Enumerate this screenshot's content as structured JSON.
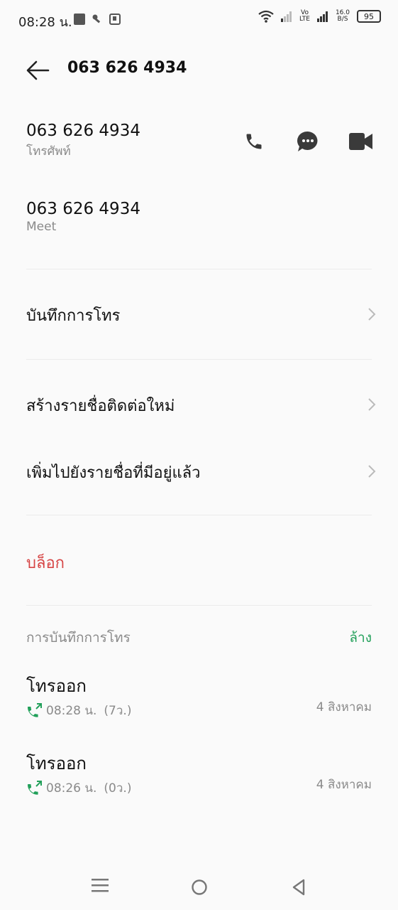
{
  "status_bar": {
    "time": "08:28 น.",
    "volte_top": "Vo",
    "volte_bottom": "LTE",
    "speed_value": "16.0",
    "speed_unit": "B/S",
    "battery": "95"
  },
  "header": {
    "title": "063 626 4934"
  },
  "numbers": [
    {
      "number": "063 626 4934",
      "label": "โทรศัพท์"
    },
    {
      "number": "063 626 4934",
      "label": "Meet"
    }
  ],
  "actions": {
    "call_history": "บันทึกการโทร",
    "create_contact": "สร้างรายชื่อติดต่อใหม่",
    "add_existing": "เพิ่มไปยังรายชื่อที่มีอยู่แล้ว",
    "block": "บล็อก"
  },
  "history": {
    "section_title": "การบันทึกการโทร",
    "clear_label": "ล้าง",
    "entries": [
      {
        "type": "โทรออก",
        "time": "08:28 น.",
        "duration": "(7ว.)",
        "date": "4 สิงหาคม"
      },
      {
        "type": "โทรออก",
        "time": "08:26 น.",
        "duration": "(0ว.)",
        "date": "4 สิงหาคม"
      }
    ]
  },
  "colors": {
    "block": "#d64545",
    "clear": "#22a05a",
    "icon": "#3a3a3a"
  }
}
